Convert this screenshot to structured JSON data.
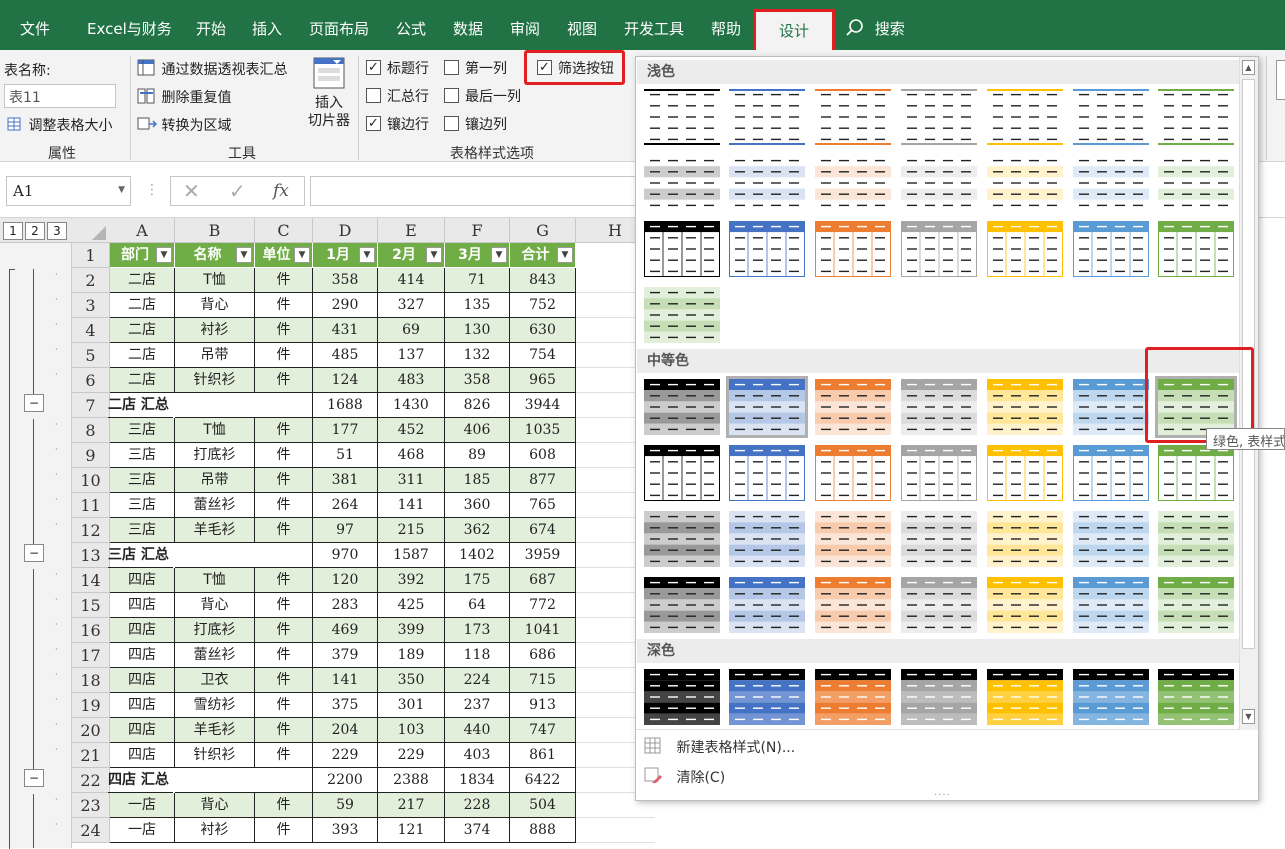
{
  "tabs": [
    "文件",
    "Excel与财务",
    "开始",
    "插入",
    "页面布局",
    "公式",
    "数据",
    "审阅",
    "视图",
    "开发工具",
    "帮助",
    "设计"
  ],
  "search_label": "搜索",
  "ribbon": {
    "table_name_label": "表名称:",
    "table_name_value": "表11",
    "resize_table": "调整表格大小",
    "group_properties": "属性",
    "pivot_summary": "通过数据透视表汇总",
    "remove_duplicates": "删除重复值",
    "convert_range": "转换为区域",
    "insert_slicer": [
      "插入",
      "切片器"
    ],
    "group_tools": "工具",
    "options": {
      "header_row": "标题行",
      "first_col": "第一列",
      "filter_btn": "筛选按钮",
      "total_row": "汇总行",
      "last_col": "最后一列",
      "banded_rows": "镶边行",
      "banded_cols": "镶边列"
    },
    "group_style_options": "表格样式选项"
  },
  "formula_bar": {
    "name_box": "A1",
    "fx": "fx"
  },
  "col_headers": [
    "A",
    "B",
    "C",
    "D",
    "E",
    "F",
    "G",
    "H"
  ],
  "outline_levels": [
    "1",
    "2",
    "3"
  ],
  "table_header": [
    "部门",
    "名称",
    "单位",
    "1月",
    "2月",
    "3月",
    "合计"
  ],
  "rows": [
    {
      "n": "2",
      "c": [
        "二店",
        "T恤",
        "件",
        "358",
        "414",
        "71",
        "843"
      ],
      "t": "g"
    },
    {
      "n": "3",
      "c": [
        "二店",
        "背心",
        "件",
        "290",
        "327",
        "135",
        "752"
      ],
      "t": "w"
    },
    {
      "n": "4",
      "c": [
        "二店",
        "衬衫",
        "件",
        "431",
        "69",
        "130",
        "630"
      ],
      "t": "g"
    },
    {
      "n": "5",
      "c": [
        "二店",
        "吊带",
        "件",
        "485",
        "137",
        "132",
        "754"
      ],
      "t": "w"
    },
    {
      "n": "6",
      "c": [
        "二店",
        "针织衫",
        "件",
        "124",
        "483",
        "358",
        "965"
      ],
      "t": "g"
    },
    {
      "n": "7",
      "c": [
        "二店 汇总",
        "",
        "",
        "1688",
        "1430",
        "826",
        "3944"
      ],
      "t": "s"
    },
    {
      "n": "8",
      "c": [
        "三店",
        "T恤",
        "件",
        "177",
        "452",
        "406",
        "1035"
      ],
      "t": "g"
    },
    {
      "n": "9",
      "c": [
        "三店",
        "打底衫",
        "件",
        "51",
        "468",
        "89",
        "608"
      ],
      "t": "w"
    },
    {
      "n": "10",
      "c": [
        "三店",
        "吊带",
        "件",
        "381",
        "311",
        "185",
        "877"
      ],
      "t": "g"
    },
    {
      "n": "11",
      "c": [
        "三店",
        "蕾丝衫",
        "件",
        "264",
        "141",
        "360",
        "765"
      ],
      "t": "w"
    },
    {
      "n": "12",
      "c": [
        "三店",
        "羊毛衫",
        "件",
        "97",
        "215",
        "362",
        "674"
      ],
      "t": "g"
    },
    {
      "n": "13",
      "c": [
        "三店 汇总",
        "",
        "",
        "970",
        "1587",
        "1402",
        "3959"
      ],
      "t": "s"
    },
    {
      "n": "14",
      "c": [
        "四店",
        "T恤",
        "件",
        "120",
        "392",
        "175",
        "687"
      ],
      "t": "g"
    },
    {
      "n": "15",
      "c": [
        "四店",
        "背心",
        "件",
        "283",
        "425",
        "64",
        "772"
      ],
      "t": "w"
    },
    {
      "n": "16",
      "c": [
        "四店",
        "打底衫",
        "件",
        "469",
        "399",
        "173",
        "1041"
      ],
      "t": "g"
    },
    {
      "n": "17",
      "c": [
        "四店",
        "蕾丝衫",
        "件",
        "379",
        "189",
        "118",
        "686"
      ],
      "t": "w"
    },
    {
      "n": "18",
      "c": [
        "四店",
        "卫衣",
        "件",
        "141",
        "350",
        "224",
        "715"
      ],
      "t": "g"
    },
    {
      "n": "19",
      "c": [
        "四店",
        "雪纺衫",
        "件",
        "375",
        "301",
        "237",
        "913"
      ],
      "t": "w"
    },
    {
      "n": "20",
      "c": [
        "四店",
        "羊毛衫",
        "件",
        "204",
        "103",
        "440",
        "747"
      ],
      "t": "g"
    },
    {
      "n": "21",
      "c": [
        "四店",
        "针织衫",
        "件",
        "229",
        "229",
        "403",
        "861"
      ],
      "t": "w"
    },
    {
      "n": "22",
      "c": [
        "四店 汇总",
        "",
        "",
        "2200",
        "2388",
        "1834",
        "6422"
      ],
      "t": "s"
    },
    {
      "n": "23",
      "c": [
        "一店",
        "背心",
        "件",
        "59",
        "217",
        "228",
        "504"
      ],
      "t": "g"
    },
    {
      "n": "24",
      "c": [
        "一店",
        "衬衫",
        "件",
        "393",
        "121",
        "374",
        "888"
      ],
      "t": "w"
    }
  ],
  "gallery": {
    "section_light": "浅色",
    "section_medium": "中等色",
    "section_dark": "深色",
    "tooltip": "绿色, 表样式",
    "new_style": "新建表格样式(N)...",
    "clear": "清除(C)",
    "palette": [
      "#000000",
      "#4472c4",
      "#ed7d31",
      "#a5a5a5",
      "#ffc000",
      "#5b9bd5",
      "#70ad47"
    ]
  },
  "colors": {
    "excel_green": "#217346",
    "header_green": "#70ad47",
    "band_green": "#e2efda",
    "highlight_red": "#e02020"
  }
}
